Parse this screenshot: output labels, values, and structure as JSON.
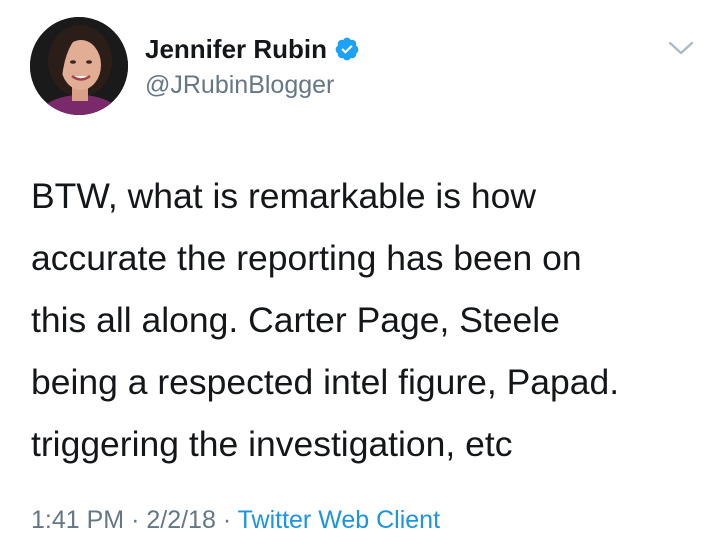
{
  "author": {
    "display_name": "Jennifer Rubin",
    "handle": "@JRubinBlogger",
    "verified": true,
    "avatar_icon": "profile-photo"
  },
  "tweet": {
    "lines": [
      "BTW, what is remarkable is how",
      "accurate the reporting has been on",
      "this all along. Carter Page, Steele",
      "being a respected intel figure, Papad.",
      "triggering the investigation, etc"
    ]
  },
  "meta": {
    "time": "1:41 PM",
    "separator": "·",
    "date": "2/2/18",
    "client": "Twitter Web Client"
  },
  "icons": {
    "verified": "verified-badge-icon",
    "menu": "chevron-down-icon"
  },
  "colors": {
    "text": "#14171a",
    "secondary": "#657786",
    "link": "#1b95e0",
    "verified": "#1da1f2"
  }
}
